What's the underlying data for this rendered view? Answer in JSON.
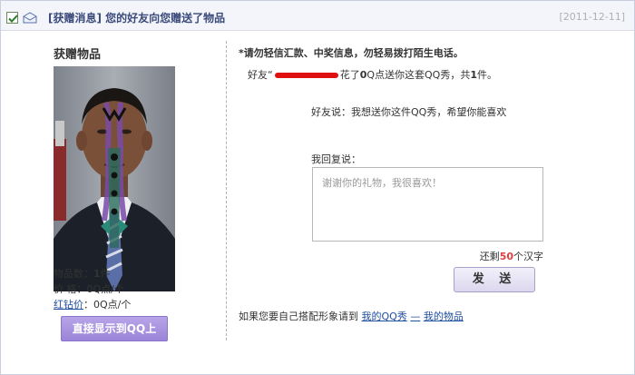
{
  "header": {
    "tag": "[获赠消息]",
    "title": "您的好友向您赠送了物品",
    "date": "[2011-12-11]"
  },
  "left": {
    "gift_title": "获赠物品",
    "count_label": "物品数：",
    "count_value": "1",
    "count_unit": "件",
    "price_label": "价 格：",
    "price_value": "0Q点/个",
    "red_diamond_label": "红钻价",
    "red_diamond_value": "：0Q点/个",
    "show_button": "直接显示到QQ上"
  },
  "right": {
    "warning": "*请勿轻信汇款、中奖信息，勿轻易拨打陌生电话。",
    "friend_prefix": "好友“",
    "friend_middle": "花了",
    "friend_points": "0",
    "friend_mid2": "Q点送你这套QQ秀，共",
    "friend_count": "1",
    "friend_suffix": "件。",
    "friend_says": "好友说：我想送你这件QQ秀，希望你能喜欢",
    "reply_label": "我回复说：",
    "reply_placeholder": "谢谢你的礼物，我很喜欢！",
    "remaining_prefix": "还剩",
    "remaining_num": "50",
    "remaining_suffix": "个汉字",
    "send_button": "发 送",
    "bottom_text": "如果您要自己搭配形象请到",
    "link_qqshow": "我的QQ秀",
    "link_sep": "—",
    "link_items": "我的物品"
  },
  "colors": {
    "accent": "#3a4a7a",
    "button_purple": "#9a84d8",
    "link": "#1f4ea0",
    "remaining": "#e04040",
    "redaction": "#e01010"
  }
}
